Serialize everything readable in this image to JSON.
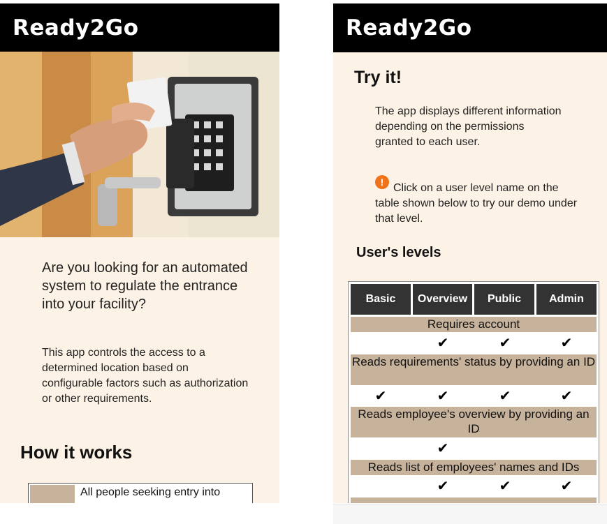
{
  "brand": "Ready2Go",
  "left": {
    "intro": "Are you looking for an automated system to regulate the entrance into your facility?",
    "description": "This app controls the access to a determined location based on configurable factors such as authorization or other requirements.",
    "how_title": "How it works",
    "table_first_row": "All people seeking entry into"
  },
  "right": {
    "try_title": "Try it!",
    "paragraph": "The app displays different information depending on the permissions granted to each user.",
    "notice_icon": "exclamation-icon",
    "notice": "Click on a user level name on the table shown below to try our demo under that level.",
    "levels_title": "User's levels",
    "table": {
      "headers": [
        "Basic",
        "Overview",
        "Public",
        "Admin"
      ],
      "rows": [
        {
          "label": "Requires account",
          "checks": [
            false,
            true,
            true,
            true
          ]
        },
        {
          "label": "Reads requirements' status by providing an ID",
          "checks": [
            true,
            true,
            true,
            true
          ]
        },
        {
          "label": "Reads employee's overview by providing an ID",
          "checks": [
            false,
            true,
            false,
            false
          ]
        },
        {
          "label": "Reads list of employees' names and IDs",
          "checks": [
            false,
            true,
            true,
            true
          ]
        }
      ],
      "check_symbol": "✔"
    }
  },
  "colors": {
    "header_bg": "#000000",
    "panel_bg": "#fdf2e6",
    "row_bg": "#c7b29b",
    "table_header_bg": "#333333",
    "notice_icon": "#f0731a"
  }
}
